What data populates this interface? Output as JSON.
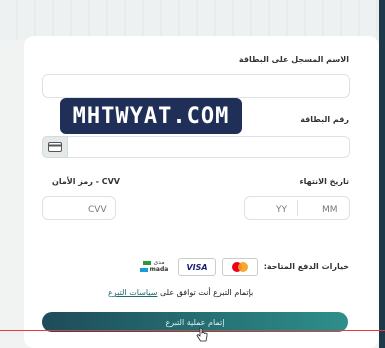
{
  "form": {
    "cardholder_label": "الاسم المسجل على البطاقة",
    "card_number_label": "رقم البطاقة",
    "expiry_label": "تاريخ الانتهاء",
    "cvv_label": "رمز الأمان - CVV",
    "expiry_month_placeholder": "MM",
    "expiry_year_placeholder": "YY",
    "cvv_placeholder": "CVV"
  },
  "watermark": {
    "text": "MHTWYAT.COM"
  },
  "payment": {
    "label": "خيارات الدفع المتاحة:",
    "methods": [
      {
        "name": "mastercard",
        "icon": "mastercard-icon"
      },
      {
        "name": "VISA",
        "icon": "visa-icon"
      },
      {
        "name": "mada",
        "icon": "mada-icon",
        "text_top": "مدى",
        "text_bottom": "mada"
      }
    ]
  },
  "agreement": {
    "prefix": "بإتمام التبرع أنت توافق على",
    "link": "سياسات التبرع"
  },
  "submit": {
    "label": "إتمام عملية التبرع"
  },
  "colors": {
    "brand_teal": "#1e6a6f",
    "watermark_bg": "#1f2f57"
  }
}
